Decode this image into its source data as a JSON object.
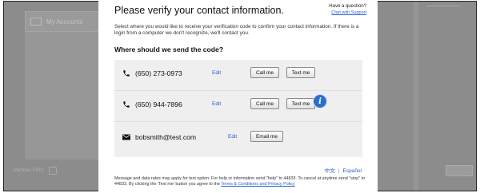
{
  "background": {
    "tile_label": "My Accounts",
    "footer_text": "Member FDIC"
  },
  "modal": {
    "title": "Please verify your contact information.",
    "help_question": "Have a question?",
    "help_link": "Chat with Support",
    "intro": "Select where you would like to receive your verification code to confirm your contact information. If there is a login from a computer we don't recognize, we'll contact you.",
    "subhead": "Where should we send the code?",
    "edit_label": "Edit",
    "contacts": [
      {
        "value": "(650) 273-0973",
        "icon": "phone-icon",
        "call_label": "Call me",
        "text_label": "Text me"
      },
      {
        "value": "(650) 944-7896",
        "icon": "phone-icon",
        "call_label": "Call me",
        "text_label": "Text me"
      },
      {
        "value": "bobsmith@test.com",
        "icon": "envelope-icon",
        "email_label": "Email me"
      }
    ],
    "info_badge": "i",
    "languages": {
      "chinese": "中文",
      "separator": "|",
      "spanish": "Español"
    },
    "disclaimer_main": "Message and data rates may apply for text option. For help or information send \"help\" to 44833. To cancel at anytime send \"stop\" to 44833. By clicking the 'Text me' button you agree to the",
    "disclaimer_link": "Terms & Conditions and Privacy Policy"
  }
}
